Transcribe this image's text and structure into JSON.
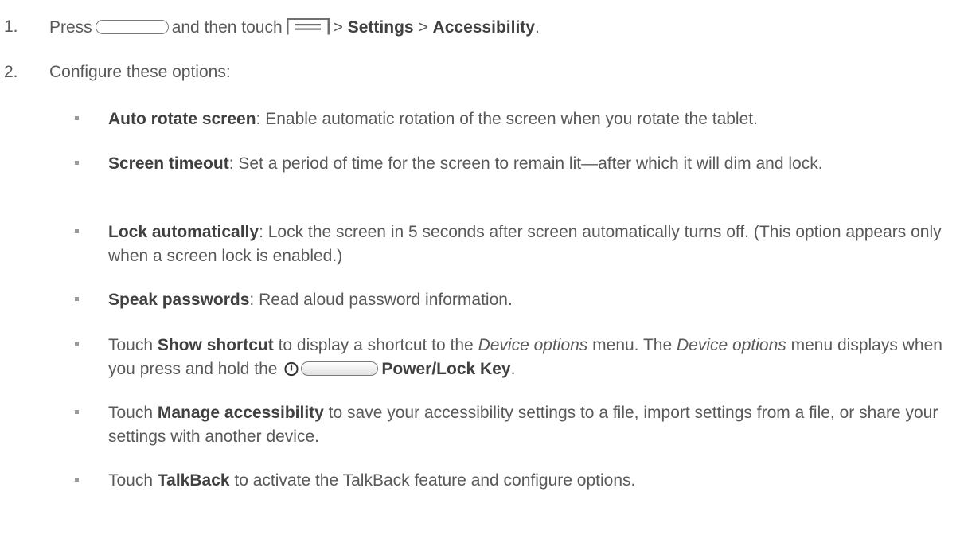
{
  "steps": [
    {
      "number": "1.",
      "t1": "Press",
      "t2": "and then touch",
      "t3": ">",
      "b1": "Settings",
      "t4": ">",
      "b2": "Accessibility",
      "t5": "."
    },
    {
      "number": "2.",
      "text": "Configure these options:"
    }
  ],
  "bullets": {
    "auto_rotate": {
      "title": "Auto rotate screen",
      "desc": ": Enable automatic rotation of the screen when you rotate the tablet."
    },
    "screen_timeout": {
      "title": "Screen timeout",
      "desc": ": Set a period of time for the screen to remain lit—after which it will dim and lock."
    },
    "lock_auto": {
      "title": "Lock automatically",
      "desc": ": Lock the screen in 5 seconds after screen automatically turns off. (This option appears only when a screen lock is enabled.)"
    },
    "speak_pw": {
      "title": "Speak passwords",
      "desc": ": Read aloud password information."
    },
    "show_shortcut": {
      "t1": "Touch",
      "b1": "Show shortcut",
      "t2": "to display a shortcut to the",
      "i1": "Device options",
      "t3": "menu. The",
      "i2": "Device options",
      "t4": "menu displays when you press and hold the",
      "b2": "Power/Lock Key",
      "t5": "."
    },
    "manage_access": {
      "t1": "Touch",
      "b1": "Manage accessibility",
      "t2": "to save your accessibility settings to a file, import settings from a file, or share your settings with another device."
    },
    "talkback": {
      "t1": "Touch",
      "b1": "TalkBack",
      "t2": "to activate the TalkBack feature and configure options."
    }
  },
  "icons": {
    "home_key": "home-key-icon",
    "menu_key": "menu-key-icon",
    "power_symbol": "power-symbol-icon",
    "power_key": "power-lock-key-icon"
  },
  "colors": {
    "text": "#595959",
    "bold": "#404040",
    "bullet": "#9a9a9a"
  }
}
